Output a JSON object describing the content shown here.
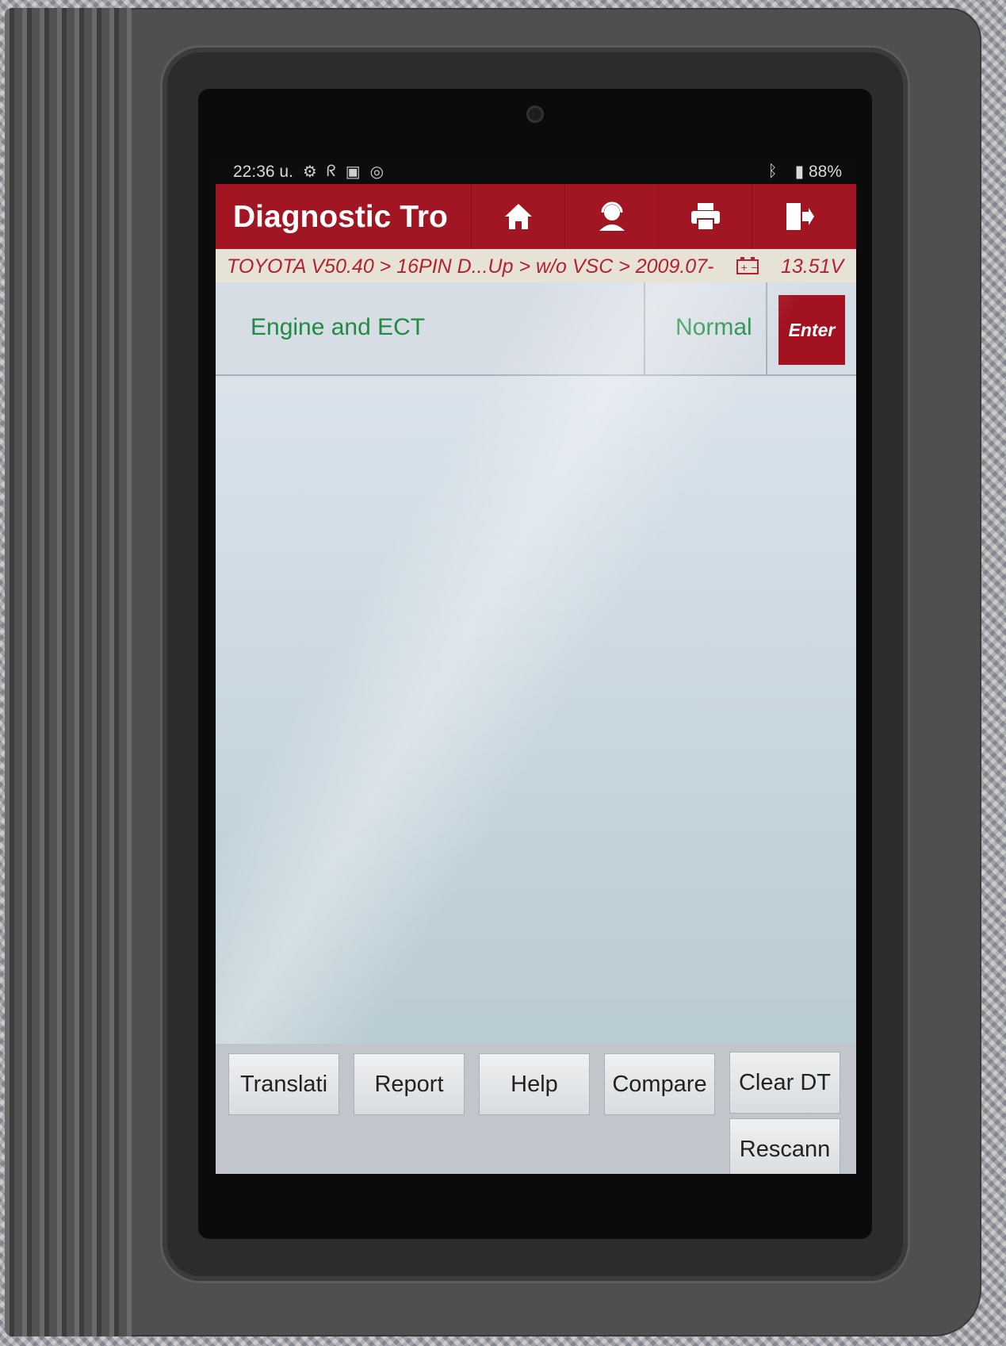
{
  "statusbar": {
    "time": "22:36 u.",
    "battery": "88%",
    "icons": [
      "gear-icon",
      "stethoscope-icon",
      "image-icon",
      "sync-icon",
      "bluetooth-icon",
      "battery-icon"
    ]
  },
  "appbar": {
    "title": "Diagnostic Tro",
    "actions": [
      "home-icon",
      "support-agent-icon",
      "print-icon",
      "exit-icon"
    ],
    "color": "#a11622"
  },
  "breadcrumb": {
    "path": "TOYOTA V50.40 > 16PIN D...Up > w/o VSC > 2009.07-",
    "voltage": "13.51V"
  },
  "systems": [
    {
      "name": "Engine and ECT",
      "status": "Normal",
      "action": "Enter"
    }
  ],
  "buttons": {
    "translation": "Translati",
    "report": "Report",
    "help": "Help",
    "compare": "Compare",
    "clear_dtc": "Clear DT",
    "rescan": "Rescann"
  },
  "navbar": [
    "back-icon",
    "home-circle-icon",
    "recents-icon"
  ]
}
